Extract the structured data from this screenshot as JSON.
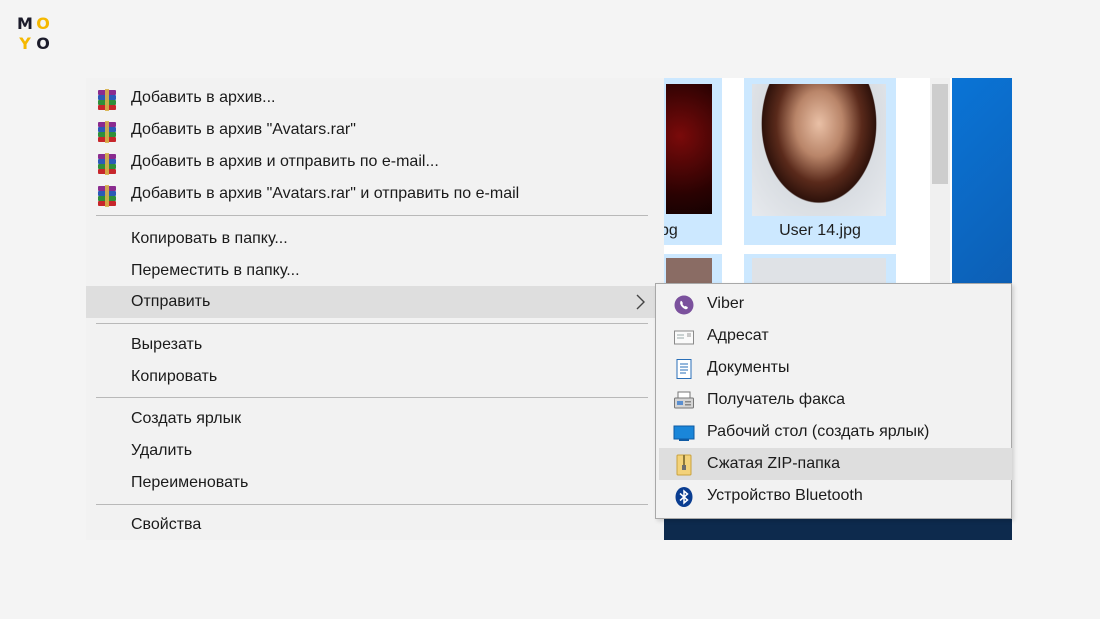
{
  "logo": {
    "letters": [
      "M",
      "O",
      "Y",
      "O"
    ]
  },
  "explorer": {
    "files": [
      {
        "label": "pg"
      },
      {
        "label": "User 14.jpg"
      }
    ]
  },
  "menu": {
    "items": [
      {
        "label": "Добавить в архив...",
        "icon": "winrar-icon"
      },
      {
        "label": "Добавить в архив \"Avatars.rar\"",
        "icon": "winrar-icon"
      },
      {
        "label": "Добавить в архив и отправить по e-mail...",
        "icon": "winrar-icon"
      },
      {
        "label": "Добавить в архив \"Avatars.rar\" и отправить по e-mail",
        "icon": "winrar-icon"
      },
      {
        "label": "Копировать в папку..."
      },
      {
        "label": "Переместить в папку..."
      },
      {
        "label": "Отправить",
        "has_submenu": true,
        "highlighted": true
      },
      {
        "label": "Вырезать"
      },
      {
        "label": "Копировать"
      },
      {
        "label": "Создать ярлык"
      },
      {
        "label": "Удалить"
      },
      {
        "label": "Переименовать"
      },
      {
        "label": "Свойства"
      }
    ]
  },
  "submenu": {
    "items": [
      {
        "label": "Viber",
        "icon": "viber-icon"
      },
      {
        "label": "Адресат",
        "icon": "mail-recipient-icon"
      },
      {
        "label": "Документы",
        "icon": "documents-icon"
      },
      {
        "label": "Получатель факса",
        "icon": "fax-icon"
      },
      {
        "label": "Рабочий стол (создать ярлык)",
        "icon": "desktop-icon"
      },
      {
        "label": "Сжатая ZIP-папка",
        "icon": "zip-folder-icon",
        "highlighted": true
      },
      {
        "label": "Устройство Bluetooth",
        "icon": "bluetooth-icon"
      }
    ]
  },
  "colors": {
    "menu_bg": "#f2f2f2",
    "highlight": "#dedede",
    "selection_blue": "#cce8ff",
    "viber": "#7b519d",
    "bluetooth": "#0a3d91"
  }
}
